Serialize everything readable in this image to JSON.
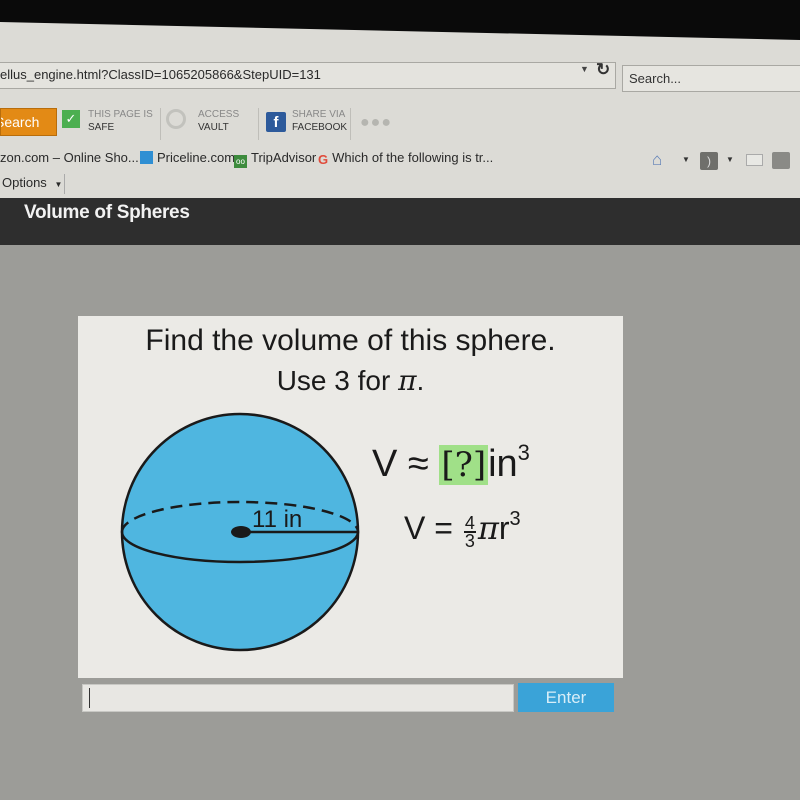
{
  "browser": {
    "address_url": "ellus_engine.html?ClassID=1065205866&StepUID=131",
    "search_placeholder": "Search..."
  },
  "toolbar": {
    "search_label": "Search",
    "safe": {
      "line1": "THIS PAGE IS",
      "line2": "SAFE"
    },
    "vault": {
      "line1": "ACCESS",
      "line2": "VAULT"
    },
    "facebook": {
      "line1": "SHARE VIA",
      "line2": "FACEBOOK"
    },
    "more_label": "●●●"
  },
  "favorites": [
    {
      "label": "zon.com – Online Sho...",
      "icon": "amazon-icon"
    },
    {
      "label": "Priceline.com",
      "icon": "priceline-icon"
    },
    {
      "label": "TripAdvisor",
      "icon": "tripadvisor-icon"
    },
    {
      "label": "Which of the following is tr...",
      "icon": "google-icon"
    }
  ],
  "options_label": "Options",
  "page": {
    "title": "Volume of Spheres"
  },
  "question": {
    "line1": "Find the volume of this sphere.",
    "line2_prefix": "Use 3 for ",
    "pi_symbol": "π",
    "line2_suffix": ".",
    "radius_label": "11 in",
    "radius_value": 11,
    "radius_unit": "in",
    "formula_answer": {
      "lhs": "V ≈ ",
      "placeholder": "[?]",
      "unit": "in",
      "exponent": "3"
    },
    "formula_volume": {
      "lhs": "V = ",
      "frac_num": "4",
      "frac_den": "3",
      "pi": "π",
      "var": "r",
      "exponent": "3"
    },
    "sphere_fill": "#4fb6e0",
    "answer_highlight": "#a0e088"
  },
  "answer": {
    "value": "",
    "enter_label": "Enter",
    "enter_color": "#3aa3d8"
  }
}
